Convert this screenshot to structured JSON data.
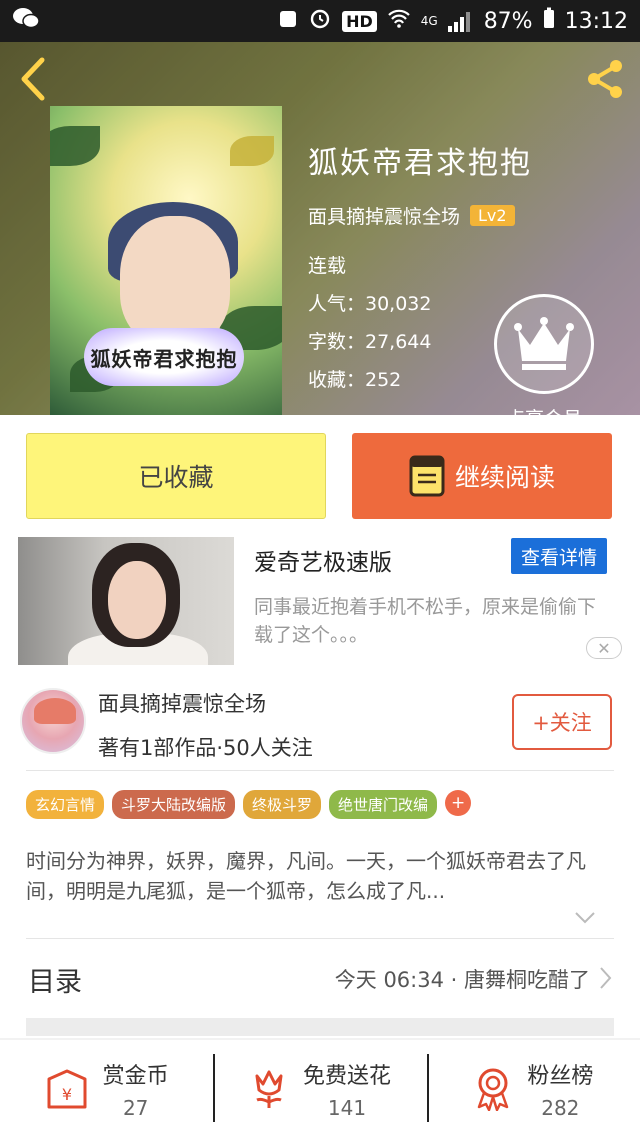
{
  "status_bar": {
    "network": "4G",
    "hd": "HD",
    "battery": "87%",
    "time": "13:12"
  },
  "book": {
    "title": "狐妖帝君求抱抱",
    "cover_title": "狐妖帝君求抱抱",
    "author": "面具摘掉震惊全场",
    "level": "Lv2",
    "status": "连载",
    "popularity_label": "人气：30,032",
    "word_count_label": "字数：27,644",
    "favorites_label": "收藏：252"
  },
  "vip": {
    "label": "点亮会员"
  },
  "actions": {
    "saved_label": "已收藏",
    "continue_label": "继续阅读"
  },
  "ad": {
    "title": "爱奇艺极速版",
    "button": "查看详情",
    "description": "同事最近抱着手机不松手，原来是偷偷下载了这个。。。"
  },
  "author_card": {
    "name": "面具摘掉震惊全场",
    "stats": "著有1部作品·50人关注",
    "follow_label": "+关注"
  },
  "tags": [
    {
      "label": "玄幻言情",
      "color": "#f2b23c"
    },
    {
      "label": "斗罗大陆改编版",
      "color": "#cc6a4d"
    },
    {
      "label": "终极斗罗",
      "color": "#e0a73a"
    },
    {
      "label": "绝世唐门改编",
      "color": "#8fb94a"
    }
  ],
  "tag_add": "+",
  "synopsis": "时间分为神界，妖界，魔界，凡间。一天，一个狐妖帝君去了凡间，明明是九尾狐，是一个狐帝，怎么成了凡...",
  "toc": {
    "label": "目录",
    "latest": "今天 06:34 · 唐舞桐吃醋了"
  },
  "bottom_stats": [
    {
      "label": "赏金币",
      "value": "27",
      "icon": "reward-envelope-icon"
    },
    {
      "label": "免费送花",
      "value": "141",
      "icon": "flower-icon"
    },
    {
      "label": "粉丝榜",
      "value": "282",
      "icon": "medal-icon"
    }
  ]
}
